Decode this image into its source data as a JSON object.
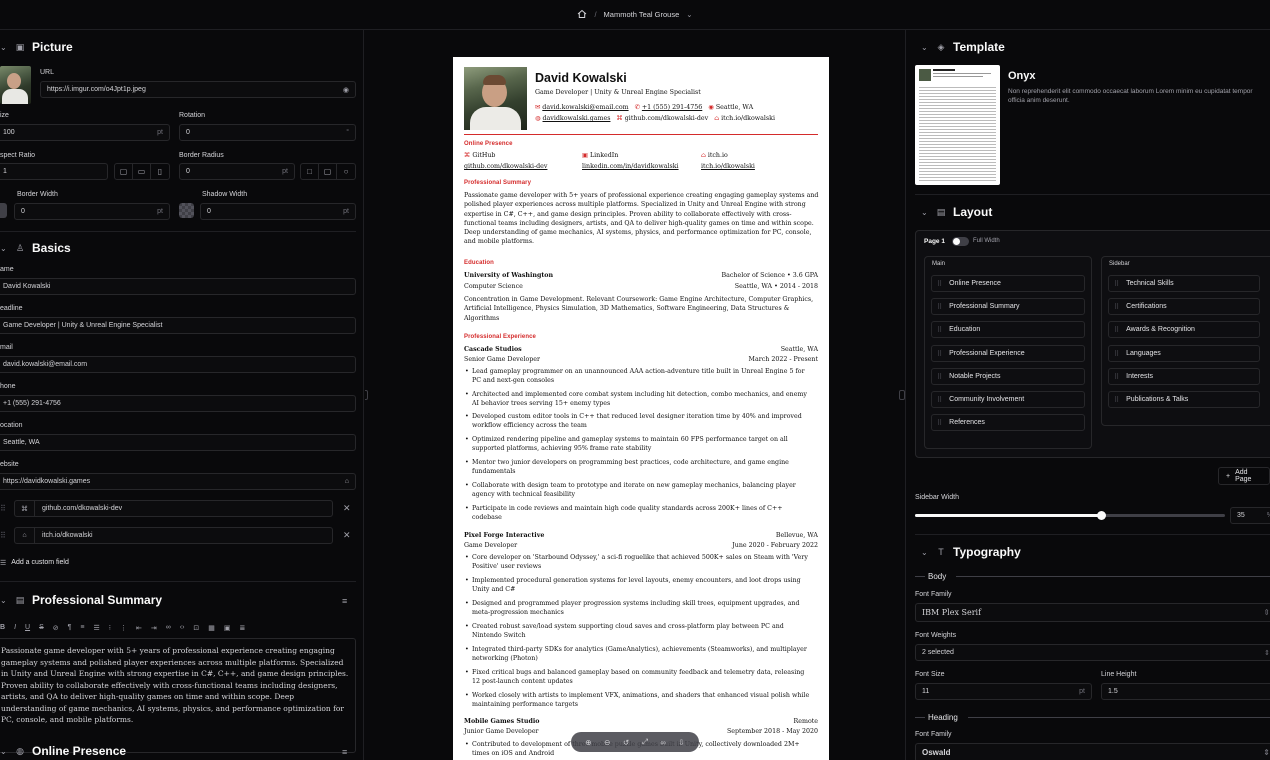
{
  "topbar": {
    "title": "Mammoth Teal Grouse"
  },
  "picture": {
    "title": "Picture",
    "url_label": "URL",
    "url_value": "https://i.imgur.com/o4Jpt1p.jpeg",
    "size_label": "ize",
    "size_value": "100",
    "size_unit": "pt",
    "rotation_label": "Rotation",
    "rotation_value": "0",
    "rotation_unit": "°",
    "aspect_label": "spect Ratio",
    "aspect_value": "1",
    "radius_label": "Border Radius",
    "radius_value": "0",
    "radius_unit": "pt",
    "bwidth_label": "Border Width",
    "bwidth_value": "0",
    "bwidth_unit": "pt",
    "shadow_label": "Shadow Width",
    "shadow_value": "0",
    "shadow_unit": "pt"
  },
  "basics": {
    "title": "Basics",
    "name_label": "ame",
    "name_value": "David Kowalski",
    "headline_label": "eadline",
    "headline_value": "Game Developer | Unity & Unreal Engine Specialist",
    "email_label": "mail",
    "email_value": "david.kowalski@email.com",
    "phone_label": "hone",
    "phone_value": "+1 (555) 291-4756",
    "location_label": "ocation",
    "location_value": "Seattle, WA",
    "website_label": "ebsite",
    "website_value": "https://davidkowalski.games",
    "custom1": "github.com/dkowalski-dev",
    "custom2": "itch.io/dkowalski",
    "add_field": "Add a custom field"
  },
  "summary_editor": {
    "title": "Professional Summary",
    "text": "Passionate game developer with 5+ years of professional experience creating engaging gameplay systems and polished player experiences across multiple platforms. Specialized in Unity and Unreal Engine with strong expertise in C#, C++, and game design principles. Proven ability to collaborate effectively with cross-functional teams including designers, artists, and QA to deliver high-quality games on time and within scope. Deep understanding of game mechanics, AI systems, physics, and performance optimization for PC, console, and mobile platforms."
  },
  "online_presence_title": "Online Presence",
  "resume": {
    "name": "David Kowalski",
    "headline": "Game Developer | Unity & Unreal Engine Specialist",
    "email": "david.kowalski@email.com",
    "phone": "+1 (555) 291-4756",
    "location": "Seattle, WA",
    "website": "davidkowalski.games",
    "github": "github.com/dkowalski-dev",
    "itch": "itch.io/dkowalski",
    "h_online": "Online Presence",
    "profiles": [
      {
        "network": "GitHub",
        "handle": "github.com/dkowalski-dev"
      },
      {
        "network": "LinkedIn",
        "handle": "linkedin.com/in/davidkowalski"
      },
      {
        "network": "itch.io",
        "handle": "itch.io/dkowalski"
      }
    ],
    "h_summary": "Professional Summary",
    "summary": "Passionate game developer with 5+ years of professional experience creating engaging gameplay systems and polished player experiences across multiple platforms. Specialized in Unity and Unreal Engine with strong expertise in C#, C++, and game design principles. Proven ability to collaborate effectively with cross-functional teams including designers, artists, and QA to deliver high-quality games on time and within scope. Deep understanding of game mechanics, AI systems, physics, and performance optimization for PC, console, and mobile platforms.",
    "h_education": "Education",
    "edu_school": "University of Washington",
    "edu_degree": "Bachelor of Science • 3.6 GPA",
    "edu_field": "Computer Science",
    "edu_where": "Seattle, WA • 2014 - 2018",
    "edu_desc": "Concentration in Game Development. Relevant Coursework: Game Engine Architecture, Computer Graphics, Artificial Intelligence, Physics Simulation, 3D Mathematics, Software Engineering, Data Structures & Algorithms",
    "h_experience": "Professional Experience",
    "jobs": [
      {
        "company": "Cascade Studios",
        "location": "Seattle, WA",
        "role": "Senior Game Developer",
        "dates": "March 2022 - Present",
        "bullets": [
          "Lead gameplay programmer on an unannounced AAA action-adventure title built in Unreal Engine 5 for PC and next-gen consoles",
          "Architected and implemented core combat system including hit detection, combo mechanics, and enemy AI behavior trees serving 15+ enemy types",
          "Developed custom editor tools in C++ that reduced level designer iteration time by 40% and improved workflow efficiency across the team",
          "Optimized rendering pipeline and gameplay systems to maintain 60 FPS performance target on all supported platforms, achieving 95% frame rate stability",
          "Mentor two junior developers on programming best practices, code architecture, and game engine fundamentals",
          "Collaborate with design team to prototype and iterate on new gameplay mechanics, balancing player agency with technical feasibility",
          "Participate in code reviews and maintain high code quality standards across 200K+ lines of C++ codebase"
        ]
      },
      {
        "company": "Pixel Forge Interactive",
        "location": "Bellevue, WA",
        "role": "Game Developer",
        "dates": "June 2020 - February 2022",
        "bullets": [
          "Core developer on 'Starbound Odyssey,' a sci-fi roguelike that achieved 500K+ sales on Steam with 'Very Positive' user reviews",
          "Implemented procedural generation systems for level layouts, enemy encounters, and loot drops using Unity and C#",
          "Designed and programmed player progression systems including skill trees, equipment upgrades, and meta-progression mechanics",
          "Created robust save/load system supporting cloud saves and cross-platform play between PC and Nintendo Switch",
          "Integrated third-party SDKs for analytics (GameAnalytics), achievements (Steamworks), and multiplayer networking (Photon)",
          "Fixed critical bugs and balanced gameplay based on community feedback and telemetry data, releasing 12 post-launch content updates",
          "Worked closely with artists to implement VFX, animations, and shaders that enhanced visual polish while maintaining performance targets"
        ]
      },
      {
        "company": "Mobile Games Studio",
        "location": "Remote",
        "role": "Junior Game Developer",
        "dates": "September 2018 - May 2020",
        "bullets": [
          "Contributed to development of three mobile puzzle games built in Unity, collectively downloaded 2M+ times on iOS and Android"
        ]
      }
    ]
  },
  "template": {
    "title": "Template",
    "name": "Onyx",
    "desc": "Non reprehenderit elit commodo occaecat laborum Lorem minim eu cupidatat tempor officia anim deserunt."
  },
  "layout": {
    "title": "Layout",
    "page_label": "Page 1",
    "full_width": "Full Width",
    "main_label": "Main",
    "sidebar_label": "Sidebar",
    "main": [
      "Online Presence",
      "Professional Summary",
      "Education",
      "Professional Experience",
      "Notable Projects",
      "Community Involvement",
      "References"
    ],
    "sidebar": [
      "Technical Skills",
      "Certifications",
      "Awards & Recognition",
      "Languages",
      "Interests",
      "Publications & Talks"
    ],
    "add_page": "Add Page",
    "sidebar_width_label": "Sidebar Width",
    "sidebar_width": "35",
    "sidebar_width_unit": "%",
    "sidebar_width_fraction": 0.35
  },
  "typography": {
    "title": "Typography",
    "body_label": "Body",
    "ff_label": "Font Family",
    "ff_value": "IBM Plex Serif",
    "fw_label": "Font Weights",
    "fw_value": "2 selected",
    "fs_label": "Font Size",
    "fs_value": "11",
    "fs_unit": "pt",
    "lh_label": "Line Height",
    "lh_value": "1.5",
    "heading_label": "Heading",
    "hff_label": "Font Family",
    "hff_value": "Oswald"
  }
}
